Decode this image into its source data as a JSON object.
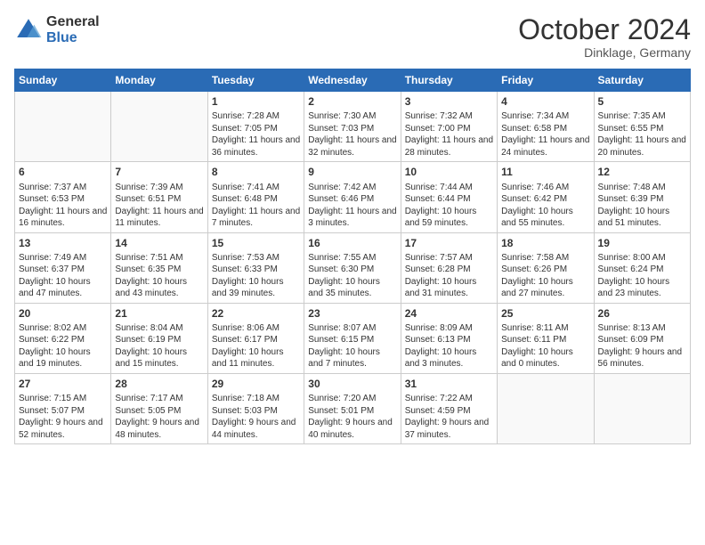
{
  "header": {
    "logo_general": "General",
    "logo_blue": "Blue",
    "month": "October 2024",
    "location": "Dinklage, Germany"
  },
  "days_of_week": [
    "Sunday",
    "Monday",
    "Tuesday",
    "Wednesday",
    "Thursday",
    "Friday",
    "Saturday"
  ],
  "weeks": [
    [
      {
        "day": "",
        "sunrise": "",
        "sunset": "",
        "daylight": ""
      },
      {
        "day": "",
        "sunrise": "",
        "sunset": "",
        "daylight": ""
      },
      {
        "day": "1",
        "sunrise": "Sunrise: 7:28 AM",
        "sunset": "Sunset: 7:05 PM",
        "daylight": "Daylight: 11 hours and 36 minutes."
      },
      {
        "day": "2",
        "sunrise": "Sunrise: 7:30 AM",
        "sunset": "Sunset: 7:03 PM",
        "daylight": "Daylight: 11 hours and 32 minutes."
      },
      {
        "day": "3",
        "sunrise": "Sunrise: 7:32 AM",
        "sunset": "Sunset: 7:00 PM",
        "daylight": "Daylight: 11 hours and 28 minutes."
      },
      {
        "day": "4",
        "sunrise": "Sunrise: 7:34 AM",
        "sunset": "Sunset: 6:58 PM",
        "daylight": "Daylight: 11 hours and 24 minutes."
      },
      {
        "day": "5",
        "sunrise": "Sunrise: 7:35 AM",
        "sunset": "Sunset: 6:55 PM",
        "daylight": "Daylight: 11 hours and 20 minutes."
      }
    ],
    [
      {
        "day": "6",
        "sunrise": "Sunrise: 7:37 AM",
        "sunset": "Sunset: 6:53 PM",
        "daylight": "Daylight: 11 hours and 16 minutes."
      },
      {
        "day": "7",
        "sunrise": "Sunrise: 7:39 AM",
        "sunset": "Sunset: 6:51 PM",
        "daylight": "Daylight: 11 hours and 11 minutes."
      },
      {
        "day": "8",
        "sunrise": "Sunrise: 7:41 AM",
        "sunset": "Sunset: 6:48 PM",
        "daylight": "Daylight: 11 hours and 7 minutes."
      },
      {
        "day": "9",
        "sunrise": "Sunrise: 7:42 AM",
        "sunset": "Sunset: 6:46 PM",
        "daylight": "Daylight: 11 hours and 3 minutes."
      },
      {
        "day": "10",
        "sunrise": "Sunrise: 7:44 AM",
        "sunset": "Sunset: 6:44 PM",
        "daylight": "Daylight: 10 hours and 59 minutes."
      },
      {
        "day": "11",
        "sunrise": "Sunrise: 7:46 AM",
        "sunset": "Sunset: 6:42 PM",
        "daylight": "Daylight: 10 hours and 55 minutes."
      },
      {
        "day": "12",
        "sunrise": "Sunrise: 7:48 AM",
        "sunset": "Sunset: 6:39 PM",
        "daylight": "Daylight: 10 hours and 51 minutes."
      }
    ],
    [
      {
        "day": "13",
        "sunrise": "Sunrise: 7:49 AM",
        "sunset": "Sunset: 6:37 PM",
        "daylight": "Daylight: 10 hours and 47 minutes."
      },
      {
        "day": "14",
        "sunrise": "Sunrise: 7:51 AM",
        "sunset": "Sunset: 6:35 PM",
        "daylight": "Daylight: 10 hours and 43 minutes."
      },
      {
        "day": "15",
        "sunrise": "Sunrise: 7:53 AM",
        "sunset": "Sunset: 6:33 PM",
        "daylight": "Daylight: 10 hours and 39 minutes."
      },
      {
        "day": "16",
        "sunrise": "Sunrise: 7:55 AM",
        "sunset": "Sunset: 6:30 PM",
        "daylight": "Daylight: 10 hours and 35 minutes."
      },
      {
        "day": "17",
        "sunrise": "Sunrise: 7:57 AM",
        "sunset": "Sunset: 6:28 PM",
        "daylight": "Daylight: 10 hours and 31 minutes."
      },
      {
        "day": "18",
        "sunrise": "Sunrise: 7:58 AM",
        "sunset": "Sunset: 6:26 PM",
        "daylight": "Daylight: 10 hours and 27 minutes."
      },
      {
        "day": "19",
        "sunrise": "Sunrise: 8:00 AM",
        "sunset": "Sunset: 6:24 PM",
        "daylight": "Daylight: 10 hours and 23 minutes."
      }
    ],
    [
      {
        "day": "20",
        "sunrise": "Sunrise: 8:02 AM",
        "sunset": "Sunset: 6:22 PM",
        "daylight": "Daylight: 10 hours and 19 minutes."
      },
      {
        "day": "21",
        "sunrise": "Sunrise: 8:04 AM",
        "sunset": "Sunset: 6:19 PM",
        "daylight": "Daylight: 10 hours and 15 minutes."
      },
      {
        "day": "22",
        "sunrise": "Sunrise: 8:06 AM",
        "sunset": "Sunset: 6:17 PM",
        "daylight": "Daylight: 10 hours and 11 minutes."
      },
      {
        "day": "23",
        "sunrise": "Sunrise: 8:07 AM",
        "sunset": "Sunset: 6:15 PM",
        "daylight": "Daylight: 10 hours and 7 minutes."
      },
      {
        "day": "24",
        "sunrise": "Sunrise: 8:09 AM",
        "sunset": "Sunset: 6:13 PM",
        "daylight": "Daylight: 10 hours and 3 minutes."
      },
      {
        "day": "25",
        "sunrise": "Sunrise: 8:11 AM",
        "sunset": "Sunset: 6:11 PM",
        "daylight": "Daylight: 10 hours and 0 minutes."
      },
      {
        "day": "26",
        "sunrise": "Sunrise: 8:13 AM",
        "sunset": "Sunset: 6:09 PM",
        "daylight": "Daylight: 9 hours and 56 minutes."
      }
    ],
    [
      {
        "day": "27",
        "sunrise": "Sunrise: 7:15 AM",
        "sunset": "Sunset: 5:07 PM",
        "daylight": "Daylight: 9 hours and 52 minutes."
      },
      {
        "day": "28",
        "sunrise": "Sunrise: 7:17 AM",
        "sunset": "Sunset: 5:05 PM",
        "daylight": "Daylight: 9 hours and 48 minutes."
      },
      {
        "day": "29",
        "sunrise": "Sunrise: 7:18 AM",
        "sunset": "Sunset: 5:03 PM",
        "daylight": "Daylight: 9 hours and 44 minutes."
      },
      {
        "day": "30",
        "sunrise": "Sunrise: 7:20 AM",
        "sunset": "Sunset: 5:01 PM",
        "daylight": "Daylight: 9 hours and 40 minutes."
      },
      {
        "day": "31",
        "sunrise": "Sunrise: 7:22 AM",
        "sunset": "Sunset: 4:59 PM",
        "daylight": "Daylight: 9 hours and 37 minutes."
      },
      {
        "day": "",
        "sunrise": "",
        "sunset": "",
        "daylight": ""
      },
      {
        "day": "",
        "sunrise": "",
        "sunset": "",
        "daylight": ""
      }
    ]
  ]
}
